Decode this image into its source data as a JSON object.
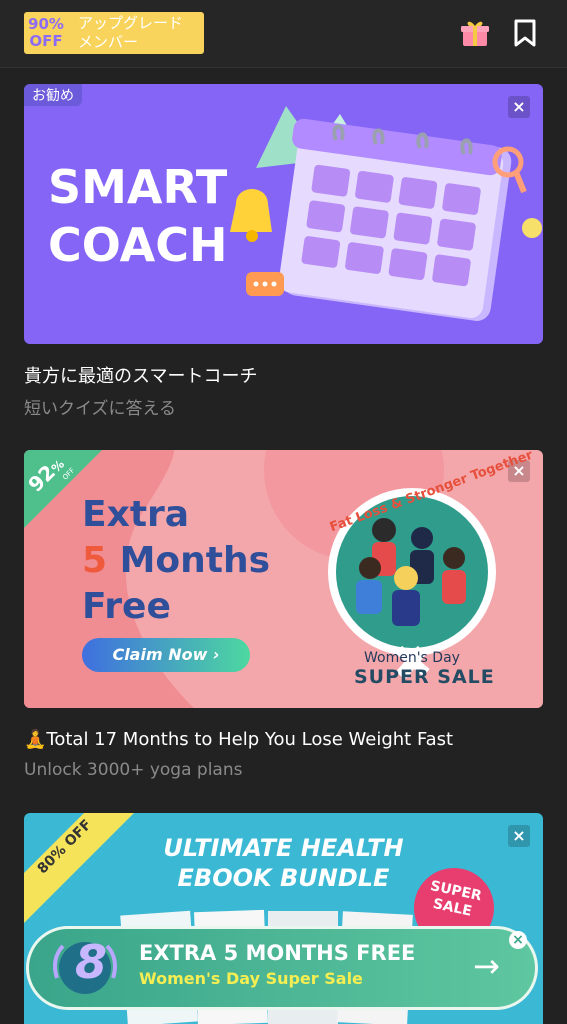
{
  "header": {
    "upgrade_pct": "90%",
    "upgrade_off": "OFF",
    "upgrade_line1": "アップグレード",
    "upgrade_line2": "メンバー"
  },
  "cards": [
    {
      "badge": "お勧め",
      "close": "×",
      "image_text_1": "SMART",
      "image_text_2": "COACH",
      "title": "貴方に最適のスマートコーチ",
      "subtitle": "短いクイズに答える"
    },
    {
      "close": "×",
      "corner_pct": "92",
      "corner_pct_sign": "%",
      "corner_off": "OFF",
      "line1": "Extra",
      "line2_num": "5",
      "line2_rest": "Months",
      "line3": "Free",
      "cta": "Claim Now ›",
      "arc_text": "Fat Loss & Stronger Together",
      "event_1": "Women's Day",
      "event_2": "SUPER SALE",
      "title_emoji": "🧘",
      "title": "Total 17 Months to Help You Lose Weight Fast",
      "subtitle": "Unlock 3000+ yoga plans"
    },
    {
      "close": "×",
      "ribbon": "80% OFF",
      "headline_1": "ULTIMATE HEALTH",
      "headline_2": "EBOOK BUNDLE",
      "sticker_1": "SUPER",
      "sticker_2": "SALE"
    }
  ],
  "floating_banner": {
    "number": "8",
    "line1": "EXTRA 5 MONTHS FREE",
    "line2": "Women's Day Super Sale",
    "arrow": "→",
    "close": "×"
  },
  "colors": {
    "background": "#222222",
    "card1_bg": "#8465f5",
    "card2_bg": "#f4a7aa",
    "card3_bg": "#3bb8d4",
    "upgrade_bg": "#f9d45c",
    "floating_bg": "#3fae8d"
  }
}
